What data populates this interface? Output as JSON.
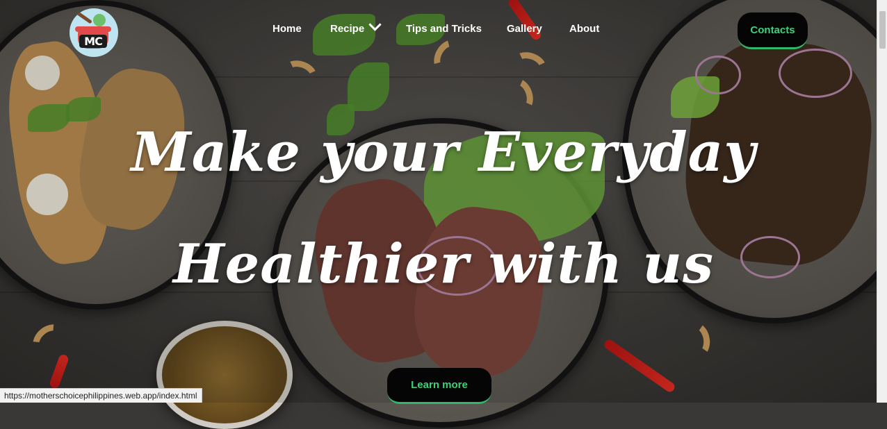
{
  "logo": {
    "text": "MC"
  },
  "nav": {
    "items": [
      {
        "label": "Home"
      },
      {
        "label": "Recipe"
      },
      {
        "label": "Tips and Tricks"
      },
      {
        "label": "Gallery"
      },
      {
        "label": "About"
      }
    ]
  },
  "contacts_label": "Contacts",
  "hero": {
    "line1": "Make your Everyday",
    "line2": "Healthier with us"
  },
  "cta_label": "Learn more",
  "status_url": "https://motherschoicephilippines.web.app/index.html",
  "colors": {
    "accent": "#3fd17a",
    "button_bg": "#050505",
    "text": "#ffffff"
  }
}
